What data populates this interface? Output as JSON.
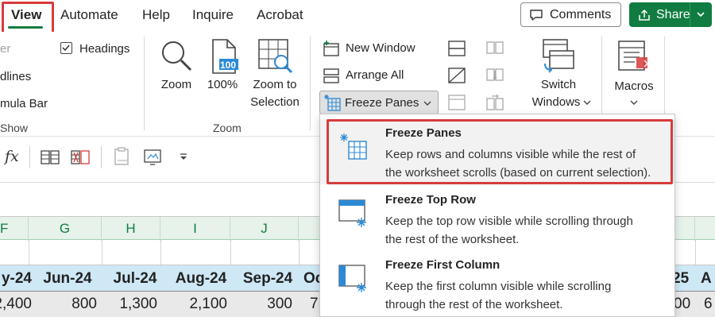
{
  "tabs": {
    "view": "View",
    "automate": "Automate",
    "help": "Help",
    "inquire": "Inquire",
    "acrobat": "Acrobat"
  },
  "header_buttons": {
    "comments": "Comments",
    "share": "Share"
  },
  "ribbon": {
    "show_group": {
      "partial_ruler": "er",
      "headings": "Headings",
      "partial_gridlines": "dlines",
      "partial_formula_bar": "mula Bar",
      "label": "Show"
    },
    "zoom_group": {
      "zoom": "Zoom",
      "hundred_percent": "100%",
      "hundred_icon_text": "100",
      "zoom_to_selection_line1": "Zoom to",
      "zoom_to_selection_line2": "Selection",
      "label": "Zoom"
    },
    "window_group": {
      "new_window": "New Window",
      "arrange_all": "Arrange All",
      "freeze_panes": "Freeze Panes",
      "switch_windows_line1": "Switch",
      "switch_windows_line2": "Windows"
    },
    "macros_group": {
      "macros": "Macros"
    }
  },
  "formula_bar": {
    "fx": "fx"
  },
  "grid": {
    "column_headers": [
      "F",
      "G",
      "H",
      "I",
      "J"
    ],
    "header_cells": [
      "y-24",
      "Jun-24",
      "Jul-24",
      "Aug-24",
      "Sep-24",
      "Oc",
      "25",
      "A"
    ],
    "value_cells": [
      "2,400",
      "800",
      "1,300",
      "2,100",
      "300",
      "7",
      "00",
      "6"
    ]
  },
  "freeze_menu": {
    "items": [
      {
        "title": "Freeze Panes",
        "desc_line1": "Keep rows and columns visible while the rest of",
        "desc_line2": "the worksheet scrolls (based on current selection)."
      },
      {
        "title": "Freeze Top Row",
        "desc_line1": "Keep the top row visible while scrolling through",
        "desc_line2": "the rest of the worksheet."
      },
      {
        "title": "Freeze First Column",
        "desc_line1": "Keep the first column visible while scrolling",
        "desc_line2": "through the rest of the worksheet."
      }
    ]
  },
  "colors": {
    "accent_green": "#107c41",
    "highlight_red": "#d83b3b",
    "header_blue": "#cfe8f6",
    "icon_blue": "#2b8ad6"
  }
}
